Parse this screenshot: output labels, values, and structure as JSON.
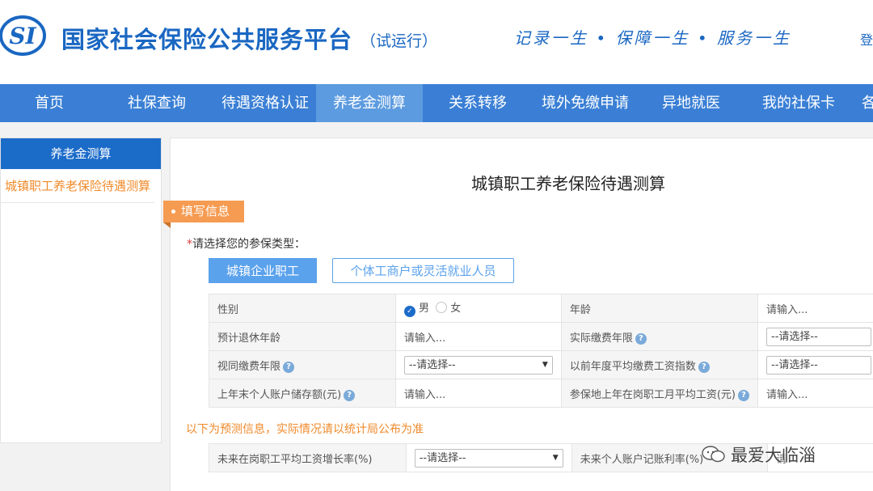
{
  "header": {
    "logo_text": "SI",
    "title": "国家社会保险公共服务平台",
    "subtitle": "（试运行）",
    "slogan": "记录一生 • 保障一生 • 服务一生",
    "login": "登"
  },
  "nav": {
    "items": [
      "首页",
      "社保查询",
      "待遇资格认证",
      "养老金测算",
      "关系转移",
      "境外免缴申请",
      "异地就医",
      "我的社保卡",
      "各"
    ],
    "active": "养老金测算"
  },
  "sidebar": {
    "title": "养老金测算",
    "items": [
      {
        "label": "城镇职工养老保险待遇测算"
      }
    ]
  },
  "form": {
    "title": "城镇职工养老保险待遇测算",
    "section_tag": "填写信息",
    "type_required_mark": "*",
    "type_label": "请选择您的参保类型：",
    "type_buttons": [
      "城镇企业职工",
      "个体工商户或灵活就业人员"
    ],
    "rows": [
      {
        "l1": "性别",
        "gender_male": "男",
        "gender_female": "女",
        "l2": "年龄",
        "v2": "请输入..."
      },
      {
        "l1": "预计退休年龄",
        "v1": "请输入...",
        "l2": "实际缴费年限",
        "v2": "--请选择--"
      },
      {
        "l1": "视同缴费年限",
        "v1": "--请选择--",
        "l2": "以前年度平均缴费工资指数",
        "v2": "--请选择--"
      },
      {
        "l1": "上年末个人账户储存额(元)",
        "v1": "请输入...",
        "l2": "参保地上年在岗职工月平均工资(元)",
        "v2": "请输入..."
      }
    ],
    "predict_note": "以下为预测信息，实际情况请以统计局公布为准",
    "predict_row": {
      "l1": "未来在岗职工平均工资增长率(%)",
      "v1": "--请选择--",
      "l2": "未来个人账户记账利率(%)",
      "v2": "请"
    }
  },
  "watermark": "最爱大临淄",
  "icons": {
    "help": "?",
    "check": "✓",
    "arrow": "▼"
  },
  "colors": {
    "brand": "#1a67c2",
    "nav": "#3a7fd5",
    "accent": "#f08a2b"
  }
}
